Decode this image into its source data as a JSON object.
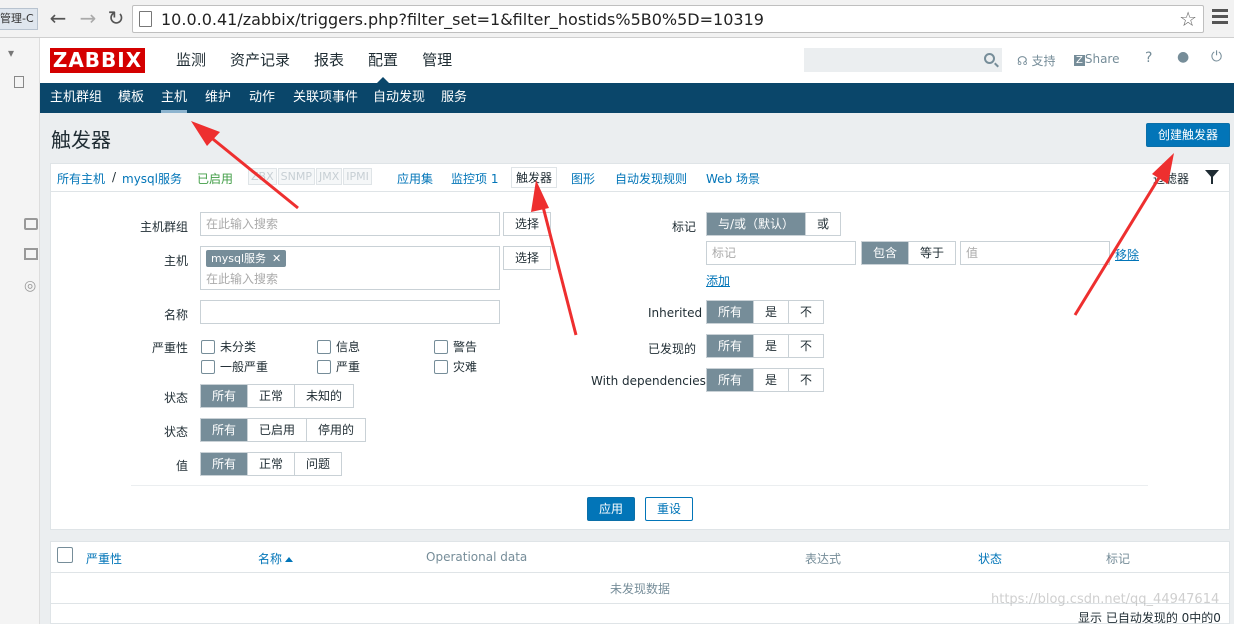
{
  "browser": {
    "tab_fragment": "管理-C",
    "address": "10.0.0.41/zabbix/triggers.php?filter_set=1&filter_hostids%5B0%5D=10319"
  },
  "header": {
    "logo": "ZABBIX",
    "menu": [
      "监测",
      "资产记录",
      "报表",
      "配置",
      "管理"
    ],
    "support": "支持",
    "share": "Share",
    "help": "?"
  },
  "subnav": [
    "主机群组",
    "模板",
    "主机",
    "维护",
    "动作",
    "关联项事件",
    "自动发现",
    "服务"
  ],
  "page": {
    "title": "触发器",
    "create_button": "创建触发器"
  },
  "host_nav": {
    "all_hosts": "所有主机",
    "separator": "/",
    "host": "mysql服务",
    "status": "已启用",
    "interfaces": [
      "ZBX",
      "SNMP",
      "JMX",
      "IPMI"
    ],
    "applications": "应用集",
    "items": "监控项 1",
    "triggers": "触发器",
    "graphs": "图形",
    "discovery": "自动发现规则",
    "web": "Web 场景",
    "filter_tab": "过滤器"
  },
  "filter": {
    "host_group_label": "主机群组",
    "host_group_placeholder": "在此输入搜索",
    "select_label": "选择",
    "host_label": "主机",
    "host_chip": "mysql服务",
    "host_placeholder": "在此输入搜索",
    "name_label": "名称",
    "severity_label": "严重性",
    "severities": [
      "未分类",
      "信息",
      "警告",
      "一般严重",
      "严重",
      "灾难"
    ],
    "state_label": "状态",
    "state_options": [
      "所有",
      "正常",
      "未知的"
    ],
    "status_label": "状态",
    "status_options": [
      "所有",
      "已启用",
      "停用的"
    ],
    "value_label": "值",
    "value_options": [
      "所有",
      "正常",
      "问题"
    ],
    "tags_label": "标记",
    "tags_options": [
      "与/或（默认）",
      "或"
    ],
    "tag_placeholder": "标记",
    "tag_ops": [
      "包含",
      "等于"
    ],
    "tag_value_placeholder": "值",
    "remove": "移除",
    "add": "添加",
    "inherited_label": "Inherited",
    "discovered_label": "已发现的",
    "dependencies_label": "With dependencies",
    "tri_options": [
      "所有",
      "是",
      "不"
    ],
    "apply": "应用",
    "reset": "重设"
  },
  "table": {
    "columns": [
      "严重性",
      "名称",
      "Operational data",
      "表达式",
      "状态",
      "标记"
    ],
    "empty": "未发现数据",
    "footer": "显示 已自动发现的 0中的0",
    "watermark": "https://blog.csdn.net/qq_44947614"
  }
}
